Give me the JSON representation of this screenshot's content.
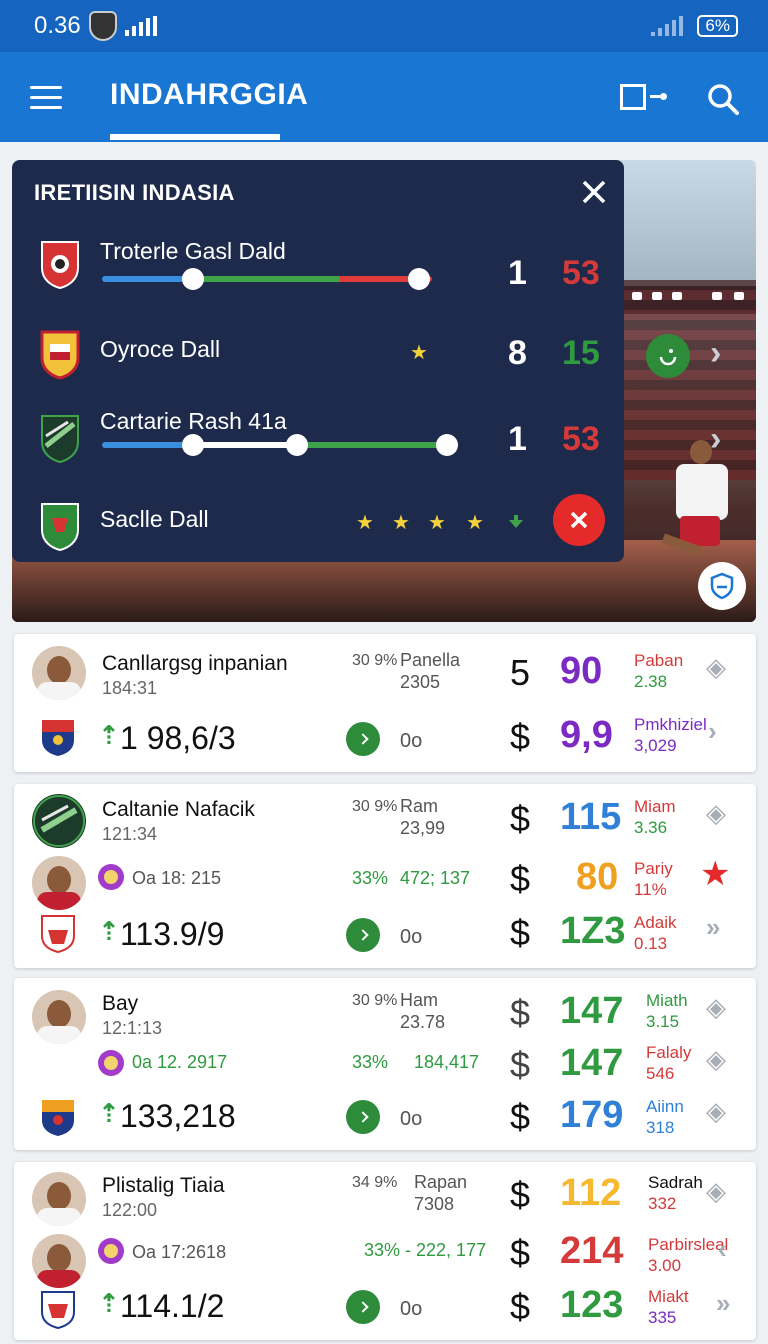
{
  "status_bar": {
    "time": "0.36",
    "battery": "6%"
  },
  "app_bar": {
    "title": "INDAHRGGIA"
  },
  "overlay": {
    "title": "IRETIISIN INDASIA",
    "rows": [
      {
        "name": "Troterle Gasl Dald",
        "n1": "1",
        "n2": "53",
        "n2_color": "#d43a3a"
      },
      {
        "name": "Oyroce Dall",
        "n1": "8",
        "n2": "15",
        "n2_color": "#2f9a3f"
      },
      {
        "name": "Cartarie Rash 41a",
        "n1": "1",
        "n2": "53",
        "n2_color": "#d43a3a"
      },
      {
        "name": "Saclle Dall"
      }
    ]
  },
  "cards": [
    {
      "name": "Canllargsg inpanian",
      "time": "184:31",
      "pct": "30 9%",
      "meta_a": "Panella",
      "meta_b": "2305",
      "r1_num": "5",
      "r1_odd": "90",
      "r1_odd_color": "#7b2bc4",
      "r1_label_a": "Paban",
      "r1_label_b": "2.38",
      "big": "1 98,6/3",
      "r2_dollar": "$",
      "r2_odd": "9,9",
      "r2_odd_color": "#7b2bc4",
      "r2_label_a": "Pmkhiziel",
      "r2_label_b": "3,029",
      "oo": "0o"
    },
    {
      "name": "Caltanie Nafacik",
      "time": "121:34",
      "pct": "30 9%",
      "meta_a": "Ram",
      "meta_b": "23,99",
      "r1_dollar": "$",
      "r1_odd": "115",
      "r1_odd_color": "#2f80d6",
      "r1_label_a": "Miam",
      "r1_label_b": "3.36",
      "sub": "Oa 18: 215",
      "sub_pct": "33%",
      "sub_val": "472; 137",
      "r2_dollar": "$",
      "r2_odd": "80",
      "r2_odd_color": "#f0a020",
      "r2_label_a": "Pariy",
      "r2_label_b": "11%",
      "big": "113.9/9",
      "r3_dollar": "$",
      "r3_odd": "1Z3",
      "r3_odd_color": "#2f9a3f",
      "r3_label_a": "Adaik",
      "r3_label_b": "0.13",
      "oo": "0o"
    },
    {
      "name": "Bay",
      "time": "12:1:13",
      "pct": "30 9%",
      "meta_a": "Ham",
      "meta_b": "23.78",
      "r1_dollar": "$",
      "r1_odd": "147",
      "r1_odd_color": "#2f9a3f",
      "r1_label_a": "Miath",
      "r1_label_b": "3.15",
      "sub": "0a 12. 2917",
      "sub_pct": "33%",
      "sub_val": "184,417",
      "r2_dollar": "$",
      "r2_odd": "147",
      "r2_odd_color": "#2f9a3f",
      "r2_label_a": "Falaly",
      "r2_label_b": "546",
      "big": "133,218",
      "r3_dollar": "$",
      "r3_odd": "179",
      "r3_odd_color": "#2f80d6",
      "r3_label_a": "Aiinn",
      "r3_label_b": "318",
      "oo": "0o"
    },
    {
      "name": "Plistalig Tiaia",
      "time": "122:00",
      "pct": "34 9%",
      "meta_a": "Rapan",
      "meta_b": "7308",
      "r1_dollar": "$",
      "r1_odd": "112",
      "r1_odd_color": "#f5b82e",
      "r1_label_a": "Sadrah",
      "r1_label_b": "332",
      "sub": "Oa 17:2618",
      "sub_pct": "33% - 222, 177",
      "r2_dollar": "$",
      "r2_odd": "214",
      "r2_odd_color": "#d43a3a",
      "r2_label_a": "Parbirsleal",
      "r2_label_b": "3.00",
      "big": "114.1/2",
      "r3_dollar": "$",
      "r3_odd": "123",
      "r3_odd_color": "#2f9a3f",
      "r3_label_a": "Miakt",
      "r3_label_b": "335",
      "oo": "0o"
    }
  ],
  "icons": {
    "status": [
      "app-shield-icon",
      "signal-icon",
      "battery-icon"
    ],
    "app_bar": [
      "menu-icon",
      "cast-icon",
      "search-icon"
    ],
    "overlay": [
      "close-icon",
      "star-icon",
      "down-arrow-icon",
      "cancel-icon"
    ],
    "cards": [
      "tag-icon",
      "chevron-right-icon",
      "star-icon",
      "go-icon",
      "up-arrow-icon"
    ]
  },
  "colors": {
    "primary": "#1976d2",
    "status_bar": "#1565c0",
    "overlay_bg": "#1d2a4c",
    "accent_red": "#e52a2a",
    "accent_green": "#2e8b3a"
  }
}
